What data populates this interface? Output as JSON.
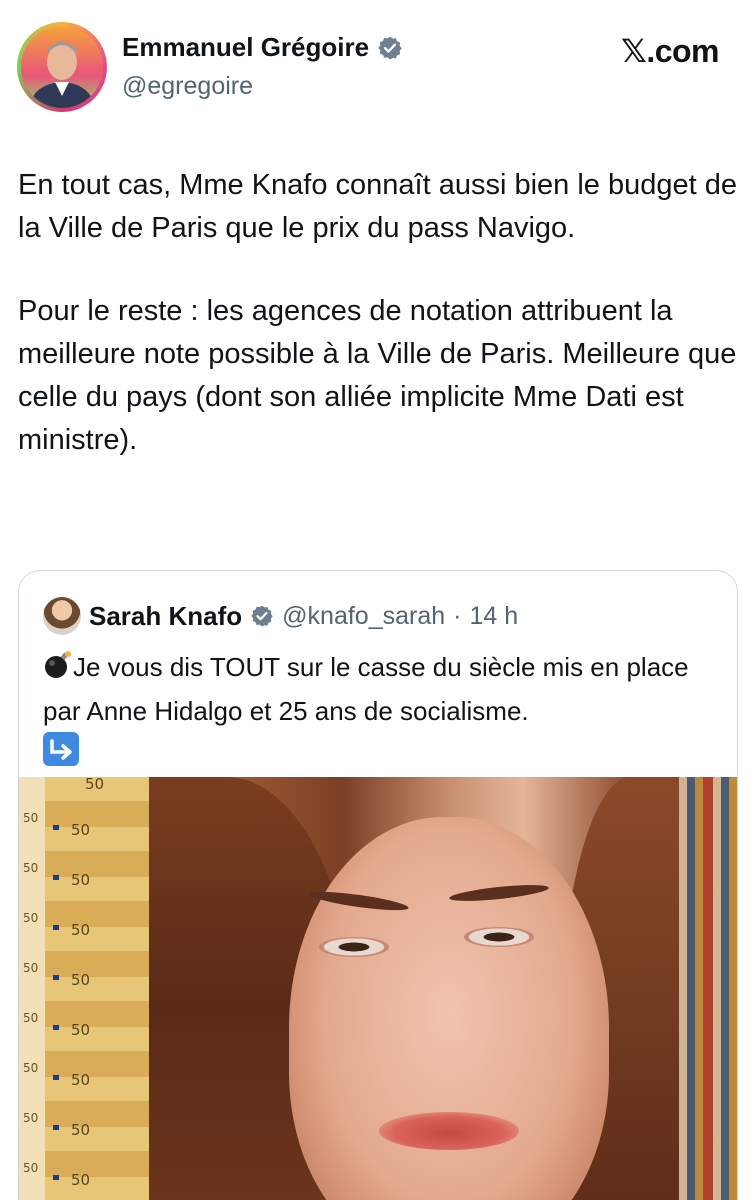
{
  "author": {
    "display_name": "Emmanuel Grégoire",
    "handle": "@egregoire",
    "verified_icon": "verified-badge-icon"
  },
  "site": {
    "label_x": "𝕏",
    "label_rest": ".com"
  },
  "tweet": {
    "paragraphs": [
      "En tout cas, Mme Knafo connaît aussi bien le budget de la Ville de Paris que le prix du pass Navigo.",
      "Pour le reste : les agences de notation attribuent la meilleure note possible à la Ville de Paris. Meilleure que celle du pays (dont son alliée implicite Mme Dati est ministre)."
    ]
  },
  "quoted_tweet": {
    "display_name": "Sarah Knafo",
    "handle": "@knafo_sarah",
    "separator": "·",
    "time": "14 h",
    "text": "Je vous dis TOUT sur le casse du siècle mis en place par Anne Hidalgo et 25 ans de socialisme.",
    "leading_emoji": "bomb-icon",
    "trailing_emoji": "arrow-down-right-icon",
    "media_note_value": "50"
  },
  "colors": {
    "text_primary": "#0f1419",
    "text_secondary": "#536471",
    "verified_blue": "#1d9bf0",
    "card_border": "#cfd9de"
  }
}
